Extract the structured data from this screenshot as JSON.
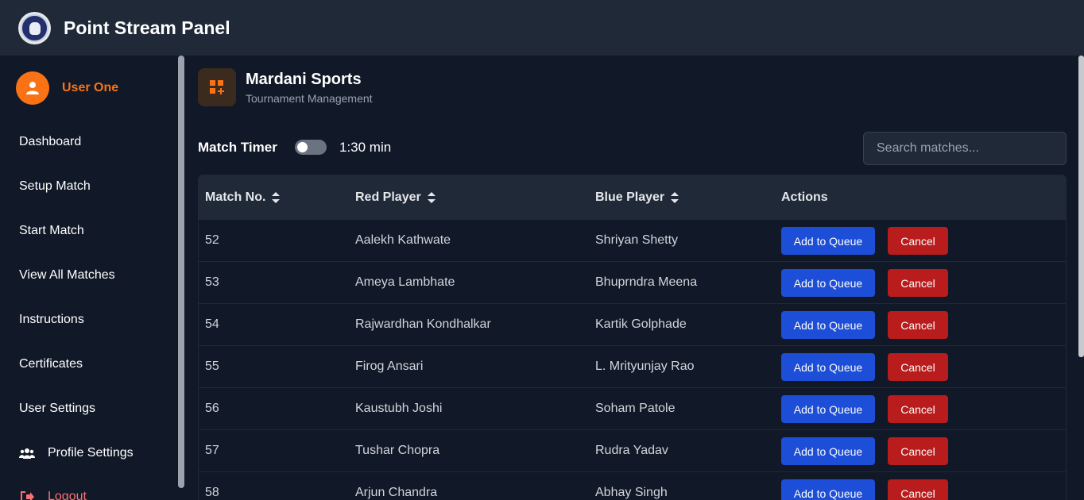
{
  "app": {
    "title": "Point Stream Panel",
    "logo_icon": "club-emblem-logo"
  },
  "sidebar": {
    "user_name": "User One",
    "items": [
      {
        "label": "Dashboard"
      },
      {
        "label": "Setup Match"
      },
      {
        "label": "Start Match"
      },
      {
        "label": "View All Matches"
      },
      {
        "label": "Instructions"
      },
      {
        "label": "Certificates"
      },
      {
        "label": "User Settings"
      },
      {
        "label": "Profile Settings",
        "icon": "users-icon"
      },
      {
        "label": "Logout",
        "icon": "logout-icon"
      }
    ]
  },
  "org": {
    "name": "Mardani Sports",
    "subtitle": "Tournament Management",
    "icon": "grid-plus-icon"
  },
  "timer": {
    "label": "Match Timer",
    "enabled": false,
    "value": "1:30 min"
  },
  "search": {
    "placeholder": "Search matches..."
  },
  "table": {
    "headers": [
      "Match No.",
      "Red Player",
      "Blue Player",
      "Actions"
    ],
    "rows": [
      {
        "match_no": "52",
        "red": "Aalekh Kathwate",
        "blue": "Shriyan Shetty"
      },
      {
        "match_no": "53",
        "red": "Ameya Lambhate",
        "blue": "Bhuprndra Meena"
      },
      {
        "match_no": "54",
        "red": "Rajwardhan Kondhalkar",
        "blue": "Kartik Golphade"
      },
      {
        "match_no": "55",
        "red": "Firog Ansari",
        "blue": "L. Mrityunjay Rao"
      },
      {
        "match_no": "56",
        "red": "Kaustubh Joshi",
        "blue": "Soham Patole"
      },
      {
        "match_no": "57",
        "red": "Tushar Chopra",
        "blue": "Rudra Yadav"
      },
      {
        "match_no": "58",
        "red": "Arjun Chandra",
        "blue": "Abhay Singh"
      }
    ],
    "queue_label": "Add to Queue",
    "cancel_label": "Cancel"
  },
  "colors": {
    "accent": "#f97316",
    "primary_button": "#1d4ed8",
    "danger_button": "#b91c1c",
    "logout": "#f87171"
  }
}
